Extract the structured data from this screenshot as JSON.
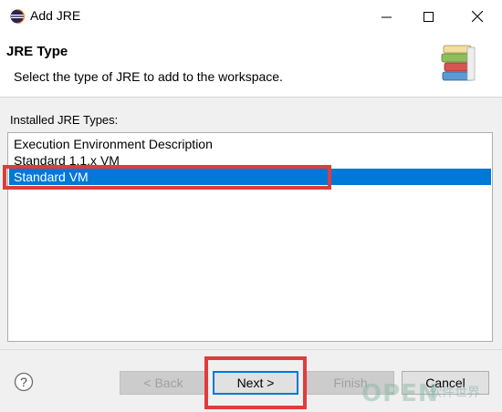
{
  "window": {
    "title": "Add JRE",
    "minimize_icon": "minimize-icon",
    "maximize_icon": "maximize-icon",
    "close_icon": "close-icon"
  },
  "header": {
    "title": "JRE Type",
    "description": "Select the type of JRE to add to the workspace.",
    "icon": "books-icon"
  },
  "list": {
    "label": "Installed JRE Types:",
    "items": [
      {
        "label": "Execution Environment Description",
        "selected": false
      },
      {
        "label": "Standard 1.1.x VM",
        "selected": false
      },
      {
        "label": "Standard VM",
        "selected": true
      }
    ],
    "selection_color": "#0078d7"
  },
  "footer": {
    "help_icon": "help-icon",
    "back_label": "< Back",
    "next_label": "Next >",
    "finish_label": "Finish",
    "cancel_label": "Cancel"
  },
  "annotation_color": "#e03c3c",
  "watermark": {
    "text": "OPEN",
    "subtext": "软件世界"
  }
}
